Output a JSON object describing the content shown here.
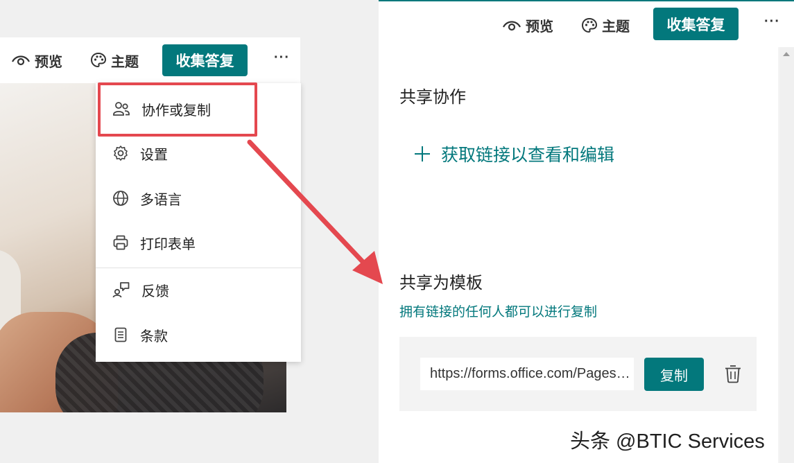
{
  "toolbar": {
    "preview_label": "预览",
    "theme_label": "主题",
    "collect_label": "收集答复",
    "more_label": "···"
  },
  "menu": {
    "items": [
      {
        "label": "协作或复制",
        "icon": "people-icon"
      },
      {
        "label": "设置",
        "icon": "gear-icon"
      },
      {
        "label": "多语言",
        "icon": "globe-icon"
      },
      {
        "label": "打印表单",
        "icon": "printer-icon"
      },
      {
        "label": "反馈",
        "icon": "feedback-icon"
      },
      {
        "label": "条款",
        "icon": "document-icon"
      }
    ]
  },
  "share_panel": {
    "collab_title": "共享协作",
    "get_link_label": "获取链接以查看和编辑",
    "template_title": "共享为模板",
    "template_desc": "拥有链接的任何人都可以进行复制",
    "link_value": "https://forms.office.com/Pages/ShareFormPage.aspx",
    "copy_label": "复制"
  },
  "watermark": "头条 @BTIC Services",
  "colors": {
    "accent": "#03787c",
    "highlight": "#e4484f"
  }
}
